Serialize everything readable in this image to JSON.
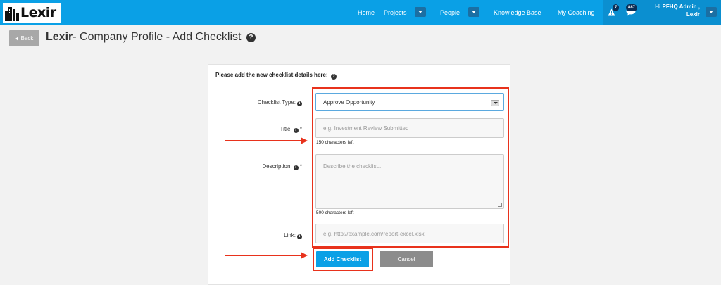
{
  "brand": {
    "name": "Lexir"
  },
  "nav": {
    "items": [
      "Home",
      "Projects",
      "People",
      "Knowledge Base",
      "My Coaching"
    ],
    "alerts_count": "7",
    "messages_count": "887",
    "user_line1": "Hi PFHQ Admin ,",
    "user_line2": "Lexir"
  },
  "header": {
    "back_label": "Back",
    "title_bold": "Lexir",
    "title_rest": "- Company Profile - Add Checklist"
  },
  "form": {
    "heading": "Please add the new checklist details here:",
    "checklist_type": {
      "label": "Checklist Type:",
      "value": "Approve Opportunity"
    },
    "title": {
      "label": "Title:",
      "required": "*",
      "placeholder": "e.g. Investment Review Submitted",
      "hint": "150 characters left"
    },
    "description": {
      "label": "Description:",
      "required": "*",
      "placeholder": "Describe the checklist...",
      "hint": "500 characters left"
    },
    "link": {
      "label": "Link:",
      "placeholder": "e.g. http://example.com/report-excel.xlsx"
    },
    "submit_label": "Add Checklist",
    "cancel_label": "Cancel"
  },
  "colors": {
    "nav_bg": "#0aa0e6",
    "primary": "#0aa0e6",
    "cancel": "#8c8c8c",
    "annotation": "#e8321c"
  },
  "icons": [
    "building-logo-icon",
    "alert-icon",
    "chat-bubble-icon",
    "help-icon",
    "info-icon",
    "caret-down-icon",
    "back-arrow-icon"
  ]
}
